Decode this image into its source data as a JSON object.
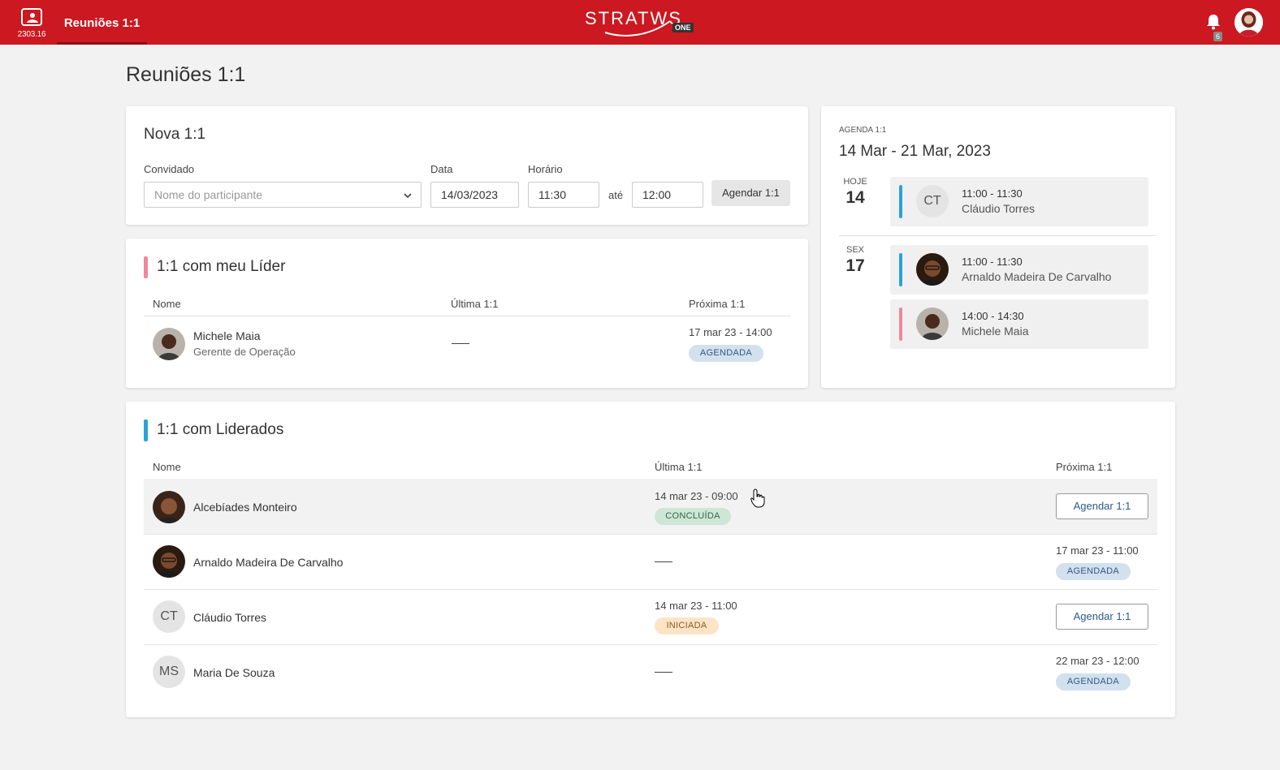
{
  "topbar": {
    "app_version": "2303.16",
    "active_tab": "Reuniões 1:1",
    "logo_text": "STRATWS",
    "logo_badge": "ONE",
    "notification_count": "6",
    "brand_color": "#cc1820"
  },
  "page": {
    "title": "Reuniões 1:1"
  },
  "new_meeting": {
    "title": "Nova 1:1",
    "guest_label": "Convidado",
    "guest_placeholder": "Nome do participante",
    "date_label": "Data",
    "date_value": "14/03/2023",
    "time_label": "Horário",
    "time_start": "11:30",
    "until_label": "até",
    "time_end": "12:00",
    "schedule_button": "Agendar 1:1"
  },
  "leader_section": {
    "title": "1:1 com meu Líder",
    "accent_color": "#f0879a",
    "columns": {
      "name": "Nome",
      "last": "Última 1:1",
      "next": "Próxima 1:1"
    },
    "rows": [
      {
        "name": "Michele Maia",
        "role": "Gerente de Operação",
        "last": "—",
        "next_datetime": "17 mar 23 - 14:00",
        "next_status": "AGENDADA"
      }
    ]
  },
  "agenda": {
    "label": "AGENDA 1:1",
    "range": "14 Mar - 21 Mar, 2023",
    "days": [
      {
        "day_name": "HOJE",
        "day_num": "14",
        "items": [
          {
            "time": "11:00 - 11:30",
            "who": "Cláudio Torres",
            "initials": "CT",
            "color": "#29a3d8"
          }
        ]
      },
      {
        "day_name": "SEX",
        "day_num": "17",
        "items": [
          {
            "time": "11:00 - 11:30",
            "who": "Arnaldo Madeira De Carvalho",
            "color": "#29a3d8"
          },
          {
            "time": "14:00 - 14:30",
            "who": "Michele Maia",
            "color": "#f0879a"
          }
        ]
      }
    ]
  },
  "led_section": {
    "title": "1:1 com Liderados",
    "accent_color": "#29a3d8",
    "columns": {
      "name": "Nome",
      "last": "Última 1:1",
      "next": "Próxima 1:1"
    },
    "rows": [
      {
        "name": "Alcebíades Monteiro",
        "last_datetime": "14 mar 23 - 09:00",
        "last_status": "CONCLUÍDA",
        "next_button": "Agendar 1:1"
      },
      {
        "name": "Arnaldo Madeira De Carvalho",
        "last": "—",
        "next_datetime": "17 mar 23 - 11:00",
        "next_status": "AGENDADA"
      },
      {
        "name": "Cláudio Torres",
        "initials": "CT",
        "last_datetime": "14 mar 23 - 11:00",
        "last_status": "INICIADA",
        "next_button": "Agendar 1:1"
      },
      {
        "name": "Maria De Souza",
        "initials": "MS",
        "last": "—",
        "next_datetime": "22 mar 23 - 12:00",
        "next_status": "AGENDADA"
      }
    ]
  }
}
